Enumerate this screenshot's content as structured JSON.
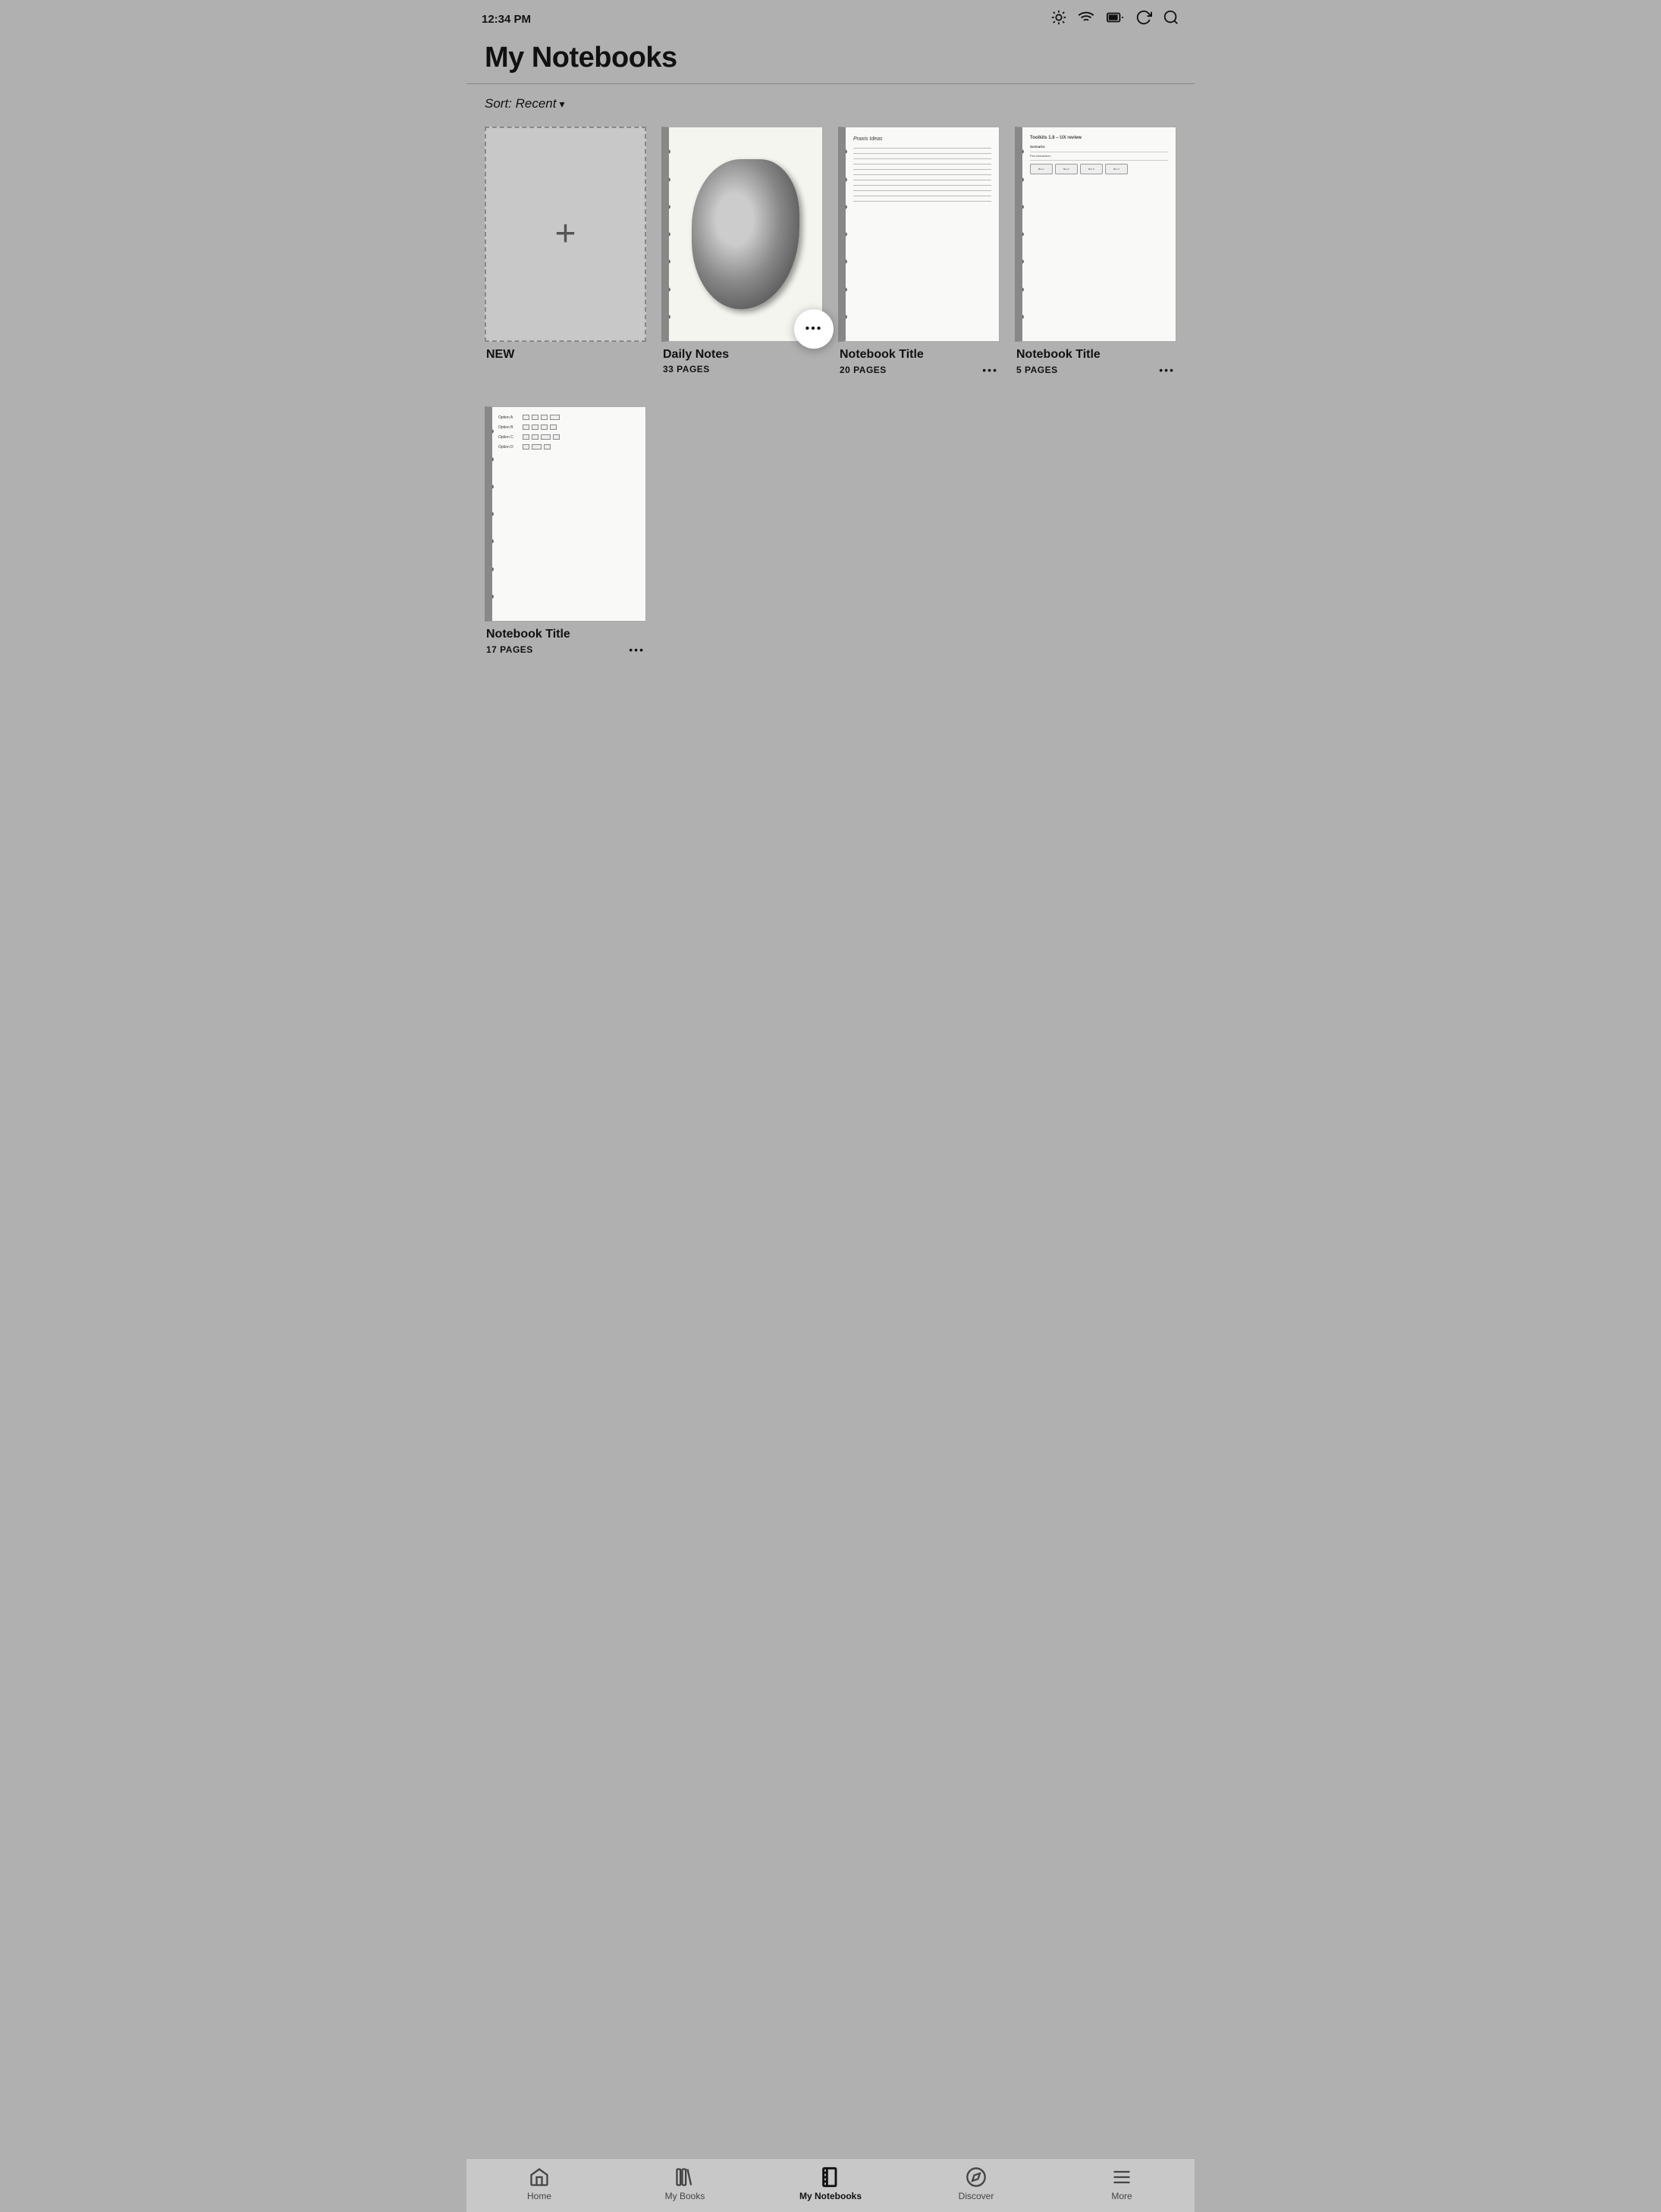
{
  "status": {
    "time": "12:34 PM"
  },
  "header": {
    "title": "My Notebooks"
  },
  "sort": {
    "label": "Sort: Recent",
    "chevron": "▾"
  },
  "notebooks": [
    {
      "id": "new",
      "type": "new",
      "name": "NEW",
      "pages": null,
      "showMore": false
    },
    {
      "id": "daily-notes",
      "type": "daily",
      "name": "Daily Notes",
      "pages": "33 PAGES",
      "showMore": true,
      "floatingMore": true
    },
    {
      "id": "notebook-2",
      "type": "lines",
      "name": "Notebook Title",
      "pages": "20 PAGES",
      "showMore": true
    },
    {
      "id": "notebook-3",
      "type": "text",
      "name": "Notebook Title",
      "pages": "5 PAGES",
      "showMore": true
    },
    {
      "id": "notebook-4",
      "type": "options",
      "name": "Notebook Title",
      "pages": "17 PAGES",
      "showMore": true
    }
  ],
  "nav": {
    "items": [
      {
        "id": "home",
        "label": "Home",
        "active": false
      },
      {
        "id": "my-books",
        "label": "My Books",
        "active": false
      },
      {
        "id": "my-notebooks",
        "label": "My Notebooks",
        "active": true
      },
      {
        "id": "discover",
        "label": "Discover",
        "active": false
      },
      {
        "id": "more",
        "label": "More",
        "active": false
      }
    ]
  },
  "more_dots": "•••",
  "cover_lines_title": "Praxis Ideas",
  "cover_text_content": {
    "title": "Toolkits 1.8 – UX review",
    "section1": "Scenario:",
    "body1": "Pen interaction:",
    "lines": [
      "",
      "",
      "",
      "",
      "",
      "",
      "",
      ""
    ]
  },
  "option_rows": [
    {
      "label": "Option A"
    },
    {
      "label": "Option B"
    },
    {
      "label": "Option C"
    },
    {
      "label": "Option D"
    }
  ]
}
